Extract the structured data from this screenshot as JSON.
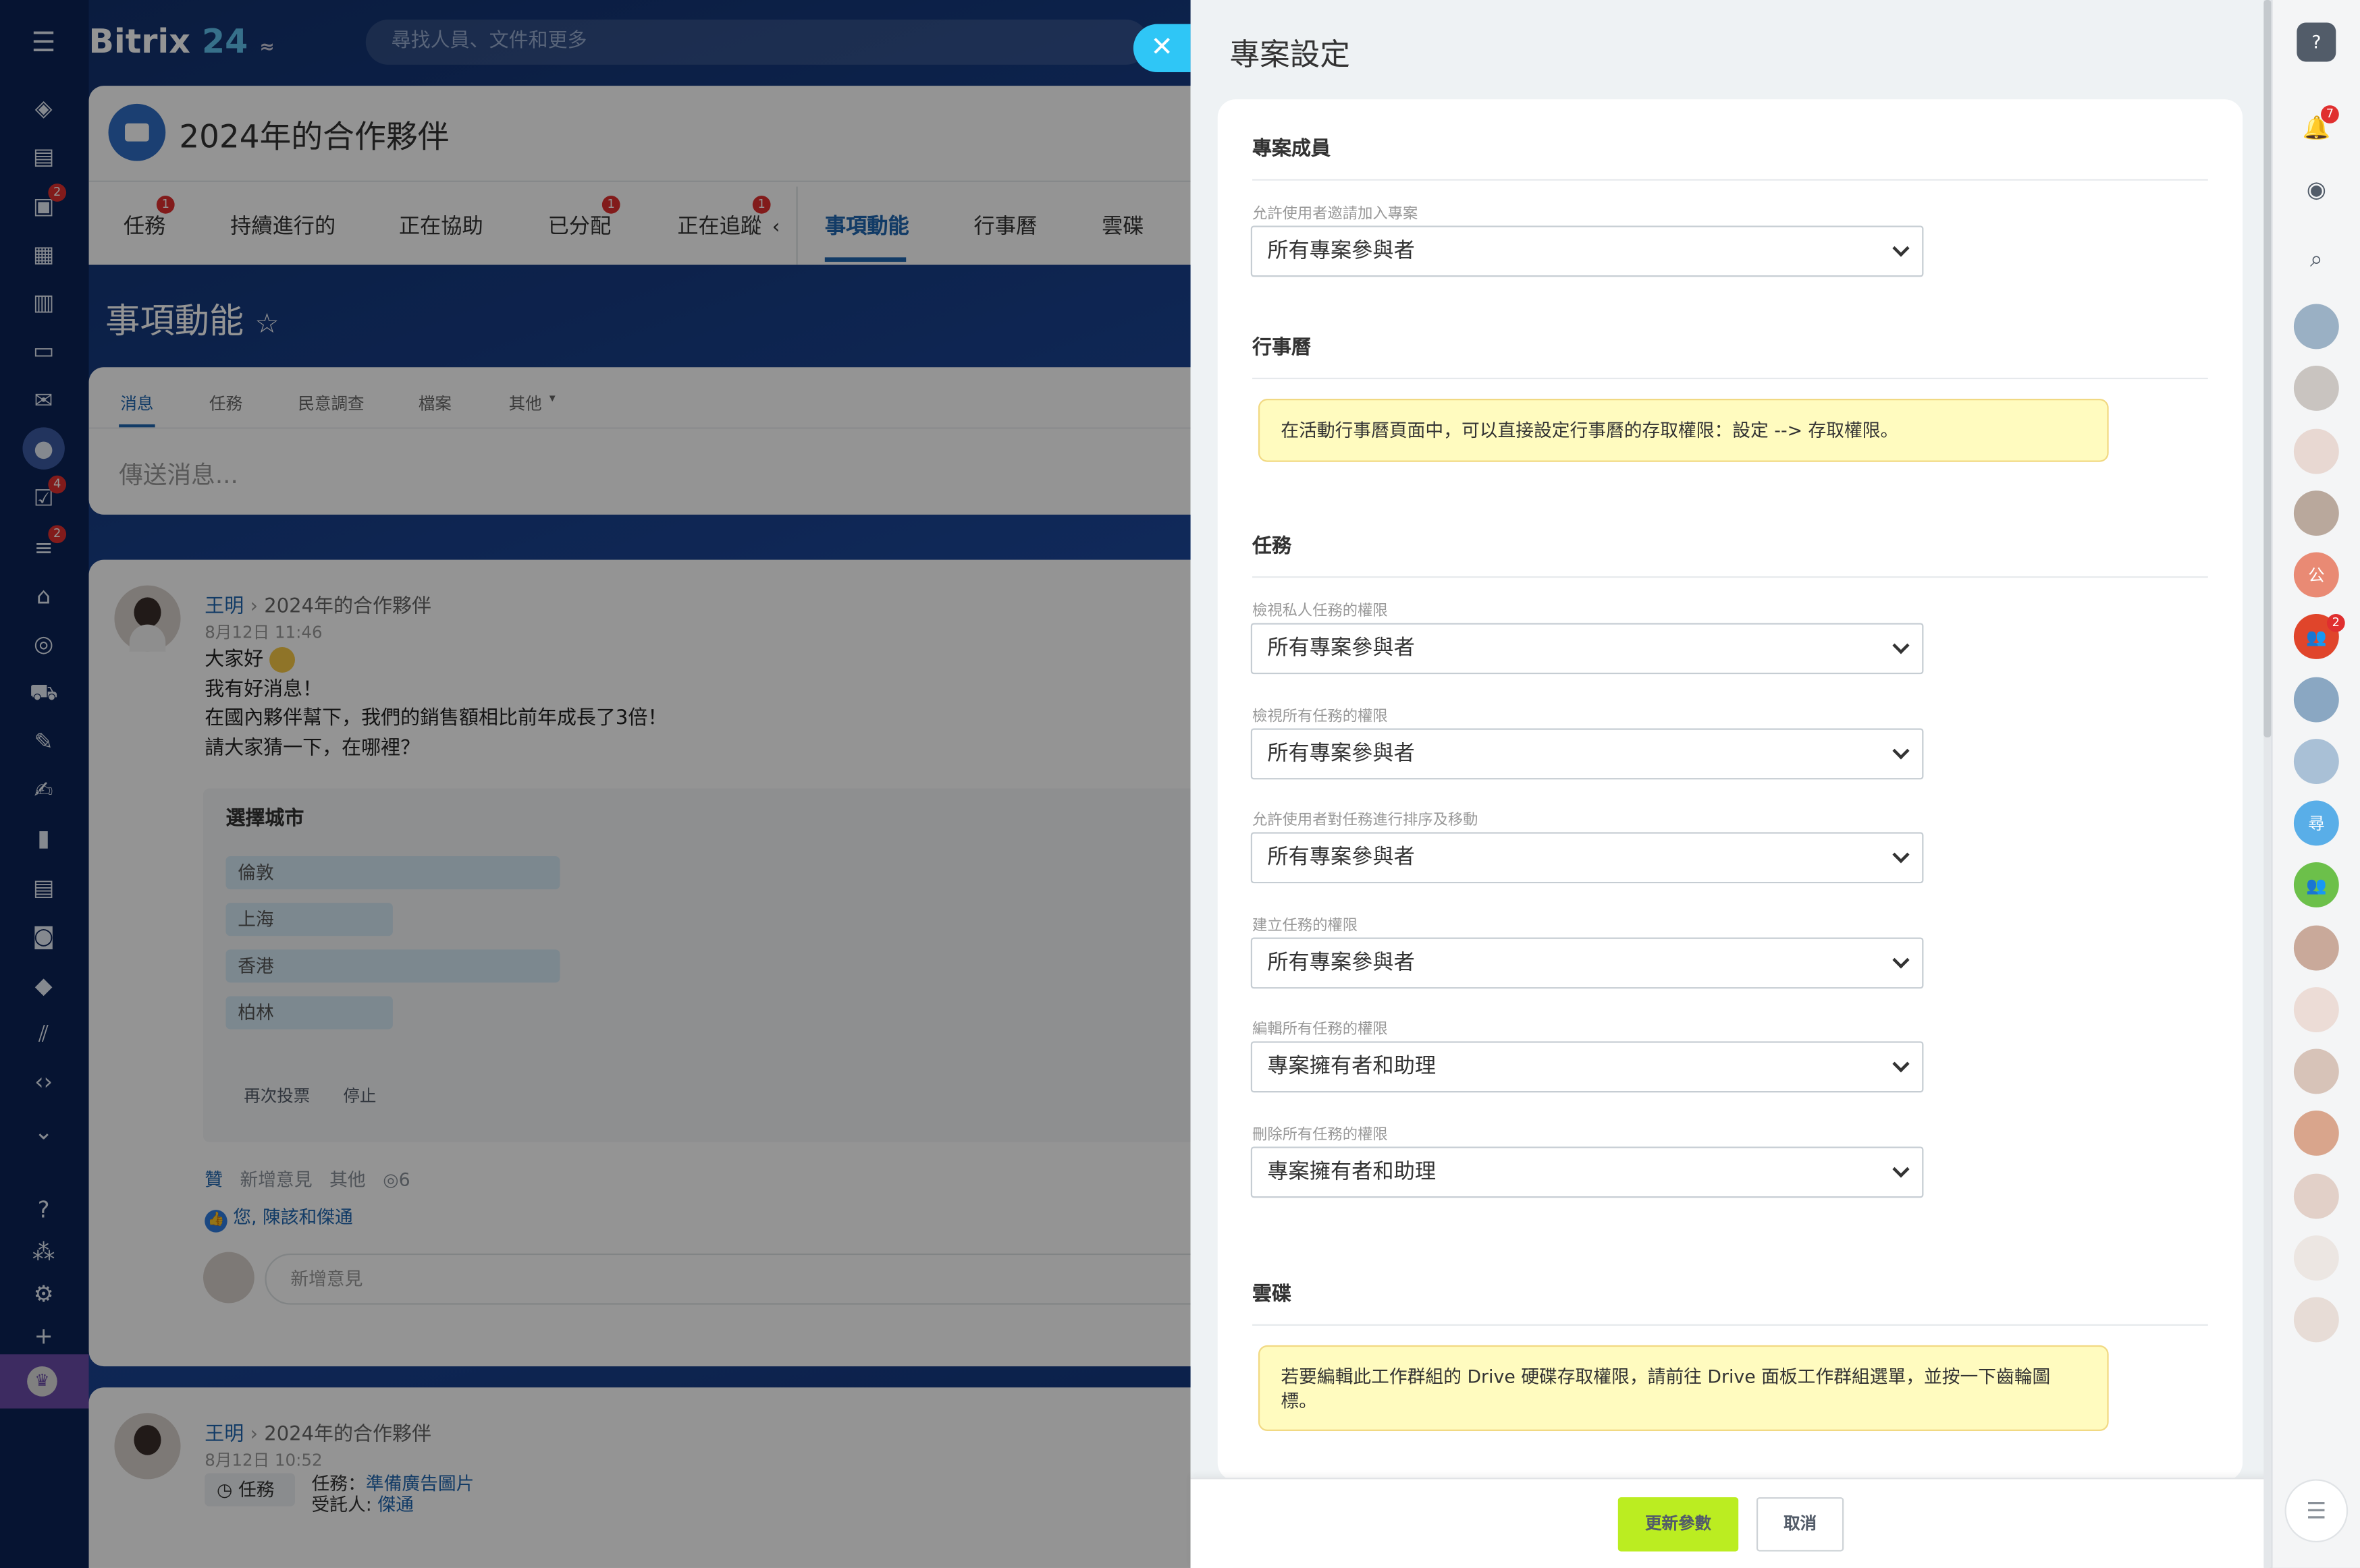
{
  "app": {
    "logo_main": "Bitrix",
    "logo_num": "24",
    "search_placeholder": "尋找人員、文件和更多"
  },
  "left_sidebar": {
    "badges": {
      "chat": "2",
      "tasks": "4",
      "feed": "2"
    }
  },
  "group": {
    "title": "2024年的合作夥伴",
    "tabs": [
      {
        "label": "任務",
        "badge": "1"
      },
      {
        "label": "持續進行的",
        "badge": ""
      },
      {
        "label": "正在協助",
        "badge": ""
      },
      {
        "label": "已分配",
        "badge": "1"
      },
      {
        "label": "正在追蹤",
        "badge": "1"
      },
      {
        "label": "事項動能",
        "badge": ""
      },
      {
        "label": "行事曆",
        "badge": ""
      },
      {
        "label": "雲碟",
        "badge": ""
      }
    ],
    "page_title": "事項動能"
  },
  "composer": {
    "tabs": [
      "消息",
      "任務",
      "民意調查",
      "檔案",
      "其他"
    ],
    "placeholder": "傳送消息..."
  },
  "post1": {
    "author": "王明",
    "target": "2024年的合作夥伴",
    "time": "8月12日 11:46",
    "lines": [
      "大家好",
      "我有好消息！",
      "在國內夥伴幫下，我們的銷售額相比前年成長了3倍！",
      "請大家猜一下，在哪裡？"
    ],
    "poll": {
      "title": "選擇城市",
      "options": [
        {
          "label": "倫敦",
          "share": 0.5
        },
        {
          "label": "上海",
          "share": 0.25
        },
        {
          "label": "香港",
          "share": 0.5
        },
        {
          "label": "柏林",
          "share": 0.25
        }
      ],
      "vote_again": "再次投票",
      "stop": "停止"
    },
    "actions": {
      "like": "贊",
      "comment": "新增意見",
      "more": "其他",
      "views": "6"
    },
    "likers": "您, 陳該和傑通",
    "comment_placeholder": "新增意見"
  },
  "post2": {
    "author": "王明",
    "target": "2024年的合作夥伴",
    "time": "8月12日 10:52",
    "tag": "任務",
    "task_label": "任務：",
    "task_link": "準備廣告圖片",
    "assignee_label": "受託人:",
    "assignee": "傑通"
  },
  "slider": {
    "title": "專案設定",
    "sections": {
      "members": "專案成員",
      "calendar": "行事曆",
      "tasks": "任務",
      "drive": "雲碟"
    },
    "fields": [
      {
        "label": "允許使用者邀請加入專案",
        "value": "所有專案參與者"
      },
      {
        "label": "檢視私人任務的權限",
        "value": "所有專案參與者"
      },
      {
        "label": "檢視所有任務的權限",
        "value": "所有專案參與者"
      },
      {
        "label": "允許使用者對任務進行排序及移動",
        "value": "所有專案參與者"
      },
      {
        "label": "建立任務的權限",
        "value": "所有專案參與者"
      },
      {
        "label": "編輯所有任務的權限",
        "value": "專案擁有者和助理"
      },
      {
        "label": "刪除所有任務的權限",
        "value": "專案擁有者和助理"
      }
    ],
    "calendar_note": "在活動行事曆頁面中，可以直接設定行事曆的存取權限：設定 --> 存取權限。",
    "drive_note": "若要編輯此工作群組的 Drive 硬碟存取權限，請前往 Drive 面板工作群組選單，並按一下齒輪圖標。",
    "save": "更新參數",
    "cancel": "取消"
  },
  "right_sidebar": {
    "notif_badge": "7",
    "group_badge": "2",
    "avatar_letters": [
      "公",
      "尋"
    ]
  },
  "colors": {
    "accent": "#2fc6f6",
    "save": "#bbed21",
    "badge": "#e02f2f",
    "link": "#2067b0"
  }
}
